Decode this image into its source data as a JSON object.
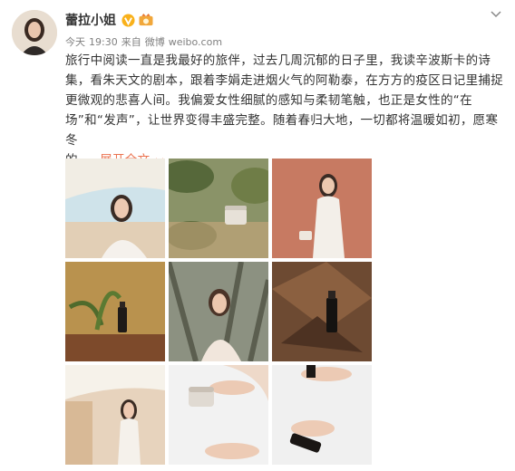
{
  "user": {
    "name": "蕾拉小姐",
    "verified_icon": "yellow-v-icon",
    "medal_icon": "medal-icon"
  },
  "meta": {
    "day": "今天",
    "time": "19:30",
    "via": "来自",
    "source": "微博",
    "domain": "weibo.com"
  },
  "body": {
    "lines": [
      "旅行中阅读一直是我最好的旅伴，过去几周沉郁的日子里，我读辛波斯卡的诗",
      "集，看朱天文的剧本，跟着李娟走进烟火气的阿勒泰，在方方的疫区日记里捕捉",
      "更微观的悲喜人间。我偏爱女性细腻的感知与柔韧笔触，也正是女性的“在",
      "场”和“发声”，让世界变得丰盛完整。随着春归大地，一切都将温暖如初，愿寒冬"
    ],
    "last_line_prefix": "的 ...",
    "expand_label": "展开全文"
  },
  "colors": {
    "accent": "#eb7350",
    "meta_gray": "#808080",
    "text": "#333333"
  },
  "photos": [
    {
      "subject": "woman-on-sunbed"
    },
    {
      "subject": "cream-jar-among-leaves"
    },
    {
      "subject": "woman-holding-cream-jar"
    },
    {
      "subject": "serum-bottle-on-log"
    },
    {
      "subject": "woman-among-trees"
    },
    {
      "subject": "serum-bottle-on-wood"
    },
    {
      "subject": "woman-posing-outdoors"
    },
    {
      "subject": "hand-holding-jar"
    },
    {
      "subject": "hand-holding-serum"
    }
  ]
}
